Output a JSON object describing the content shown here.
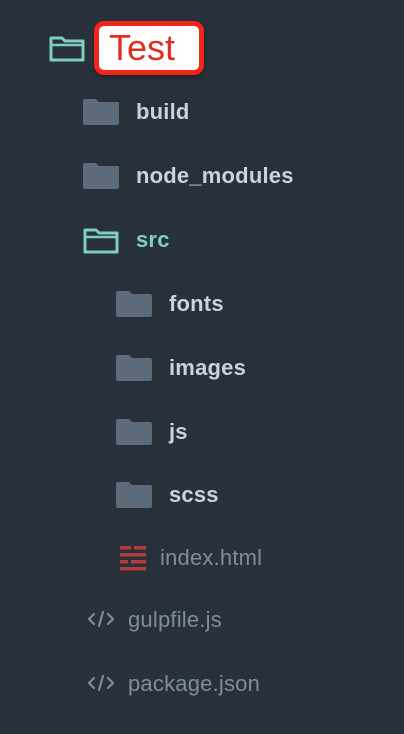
{
  "tree": {
    "root": {
      "label": "Test",
      "icon": "folder-open-icon"
    },
    "items": [
      {
        "label": "build",
        "icon": "folder-icon",
        "kind": "folder"
      },
      {
        "label": "node_modules",
        "icon": "folder-icon",
        "kind": "folder"
      },
      {
        "label": "src",
        "icon": "folder-open-icon",
        "kind": "folder-open"
      },
      {
        "label": "fonts",
        "icon": "folder-icon",
        "kind": "folder"
      },
      {
        "label": "images",
        "icon": "folder-icon",
        "kind": "folder"
      },
      {
        "label": "js",
        "icon": "folder-icon",
        "kind": "folder"
      },
      {
        "label": "scss",
        "icon": "folder-icon",
        "kind": "folder"
      },
      {
        "label": "index.html",
        "icon": "html-file-icon",
        "kind": "file"
      },
      {
        "label": "gulpfile.js",
        "icon": "code-file-icon",
        "kind": "file"
      },
      {
        "label": "package.json",
        "icon": "code-file-icon",
        "kind": "file"
      }
    ]
  },
  "colors": {
    "background": "#28313a",
    "folder": "#5b6b7a",
    "folder_open": "#7ecfc1",
    "folder_label": "#c9d3dc",
    "file_label": "#7d8d9b",
    "html_icon": "#b33c3c",
    "highlight_border": "#f3241a",
    "highlight_text": "#e02e20"
  }
}
